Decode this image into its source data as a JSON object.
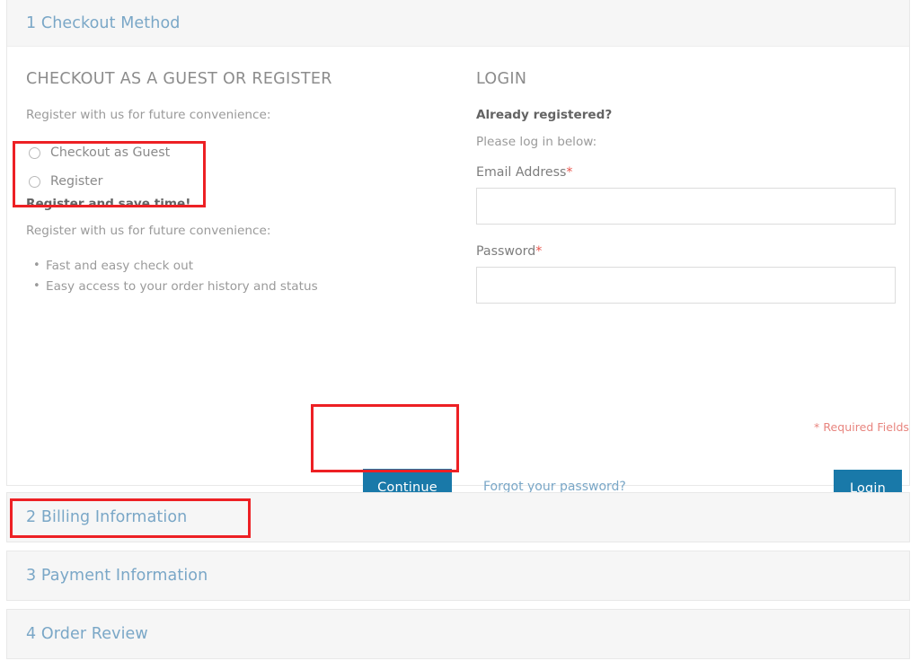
{
  "steps": [
    {
      "number": "1",
      "label": "Checkout Method",
      "title": "1 Checkout Method",
      "state": "open"
    },
    {
      "number": "2",
      "label": "Billing Information",
      "title": "2 Billing Information",
      "state": "collapsed"
    },
    {
      "number": "3",
      "label": "Payment Information",
      "title": "3 Payment Information",
      "state": "collapsed"
    },
    {
      "number": "4",
      "label": "Order Review",
      "title": "4 Order Review",
      "state": "collapsed"
    }
  ],
  "guest": {
    "heading": "CHECKOUT AS A GUEST OR REGISTER",
    "intro": "Register with us for future convenience:",
    "options": [
      {
        "label": "Checkout as Guest",
        "selected": false
      },
      {
        "label": "Register",
        "selected": false
      }
    ],
    "register_headline": "Register and save time!",
    "register_intro": "Register with us for future convenience:",
    "benefits": [
      "Fast and easy check out",
      "Easy access to your order history and status"
    ],
    "continue_label": "Continue"
  },
  "login": {
    "heading": "LOGIN",
    "already_registered": "Already registered?",
    "please_login": "Please log in below:",
    "email_label": "Email Address",
    "email_value": "",
    "email_placeholder": "",
    "password_label": "Password",
    "password_value": "",
    "password_placeholder": "",
    "required_marker": "*",
    "required_note": "* Required Fields",
    "forgot_link": "Forgot your password?",
    "login_label": "Login"
  },
  "colors": {
    "accent_blue": "#1979a9",
    "step_title_blue": "#7aa7c7",
    "required_red": "#e8554d",
    "annotation_red": "#ed2024",
    "panel_header_bg": "#f6f6f6",
    "body_text": "#9a9a9a"
  }
}
